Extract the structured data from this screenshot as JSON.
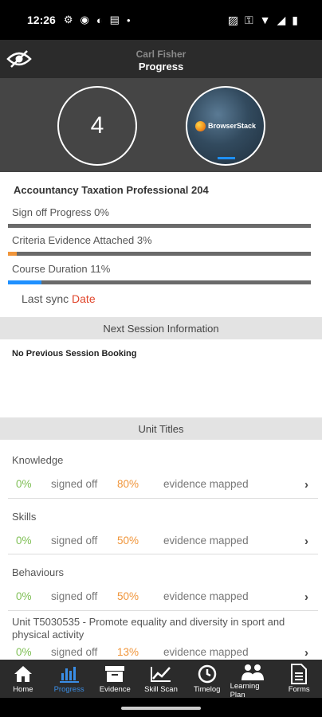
{
  "status_bar": {
    "time": "12:26"
  },
  "header": {
    "user_name": "Carl Fisher",
    "title": "Progress"
  },
  "hero": {
    "count": "4",
    "avatar_brand": "BrowserStack"
  },
  "course": {
    "title": "Accountancy Taxation Professional 204",
    "sign_off_label": "Sign off Progress",
    "sign_off_value": "0%",
    "sign_off_fraction": 0,
    "criteria_label": "Criteria Evidence Attached",
    "criteria_value": "3%",
    "criteria_fraction": 0.03,
    "duration_label": "Course Duration",
    "duration_value": "11%",
    "duration_fraction": 0.11,
    "sync_label": "Last sync",
    "sync_value": "Date"
  },
  "next_session": {
    "header": "Next Session Information",
    "message": "No Previous Session Booking"
  },
  "units": {
    "header": "Unit Titles",
    "items": [
      {
        "name": "Knowledge",
        "signed": "0%",
        "signed_label": "signed off",
        "evidence": "80%",
        "evidence_label": "evidence mapped"
      },
      {
        "name": "Skills",
        "signed": "0%",
        "signed_label": "signed off",
        "evidence": "50%",
        "evidence_label": "evidence mapped"
      },
      {
        "name": "Behaviours",
        "signed": "0%",
        "signed_label": "signed off",
        "evidence": "50%",
        "evidence_label": "evidence mapped"
      },
      {
        "name": "Unit T5030535 - Promote equality and diversity in sport and physical activity",
        "signed": "0%",
        "signed_label": "signed off",
        "evidence": "13%",
        "evidence_label": "evidence mapped"
      }
    ]
  },
  "bottom_nav": {
    "items": [
      {
        "label": "Home",
        "icon": "home-icon"
      },
      {
        "label": "Progress",
        "icon": "bar-chart-icon"
      },
      {
        "label": "Evidence",
        "icon": "archive-box-icon"
      },
      {
        "label": "Skill Scan",
        "icon": "line-chart-icon"
      },
      {
        "label": "Timelog",
        "icon": "clock-icon"
      },
      {
        "label": "Learning Plan",
        "icon": "group-icon"
      },
      {
        "label": "Forms",
        "icon": "document-icon"
      }
    ],
    "active_index": 1
  },
  "colors": {
    "accent": "#3a8ee6",
    "orange": "#f0953a",
    "green": "#7fbf55",
    "red": "#e0452b",
    "progress_blue": "#1e90ff"
  }
}
